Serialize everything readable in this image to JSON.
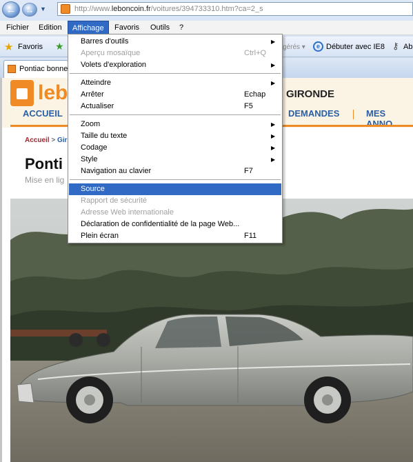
{
  "browser": {
    "url_prefix": "http://www.",
    "url_domain": "leboncoin.fr",
    "url_path": "/voitures/394733310.htm?ca=2_s",
    "menubar": [
      "Fichier",
      "Edition",
      "Affichage",
      "Favoris",
      "Outils",
      "?"
    ],
    "favorites_label": "Favoris",
    "favbar_partial": "gérés ▾",
    "ie8_label": "Débuter avec IE8",
    "ab_label": "Ab",
    "tab_title": "Pontiac bonneville"
  },
  "dropdown": {
    "items": [
      {
        "label": "Barres d'outils",
        "shortcut": "",
        "submenu": true,
        "disabled": false,
        "selected": false
      },
      {
        "label": "Aperçu mosaïque",
        "shortcut": "Ctrl+Q",
        "submenu": false,
        "disabled": true,
        "selected": false
      },
      {
        "label": "Volets d'exploration",
        "shortcut": "",
        "submenu": true,
        "disabled": false,
        "selected": false
      },
      {
        "label": "Atteindre",
        "shortcut": "",
        "submenu": true,
        "disabled": false,
        "selected": false
      },
      {
        "label": "Arrêter",
        "shortcut": "Echap",
        "submenu": false,
        "disabled": false,
        "selected": false
      },
      {
        "label": "Actualiser",
        "shortcut": "F5",
        "submenu": false,
        "disabled": false,
        "selected": false
      },
      {
        "label": "Zoom",
        "shortcut": "",
        "submenu": true,
        "disabled": false,
        "selected": false
      },
      {
        "label": "Taille du texte",
        "shortcut": "",
        "submenu": true,
        "disabled": false,
        "selected": false
      },
      {
        "label": "Codage",
        "shortcut": "",
        "submenu": true,
        "disabled": false,
        "selected": false
      },
      {
        "label": "Style",
        "shortcut": "",
        "submenu": true,
        "disabled": false,
        "selected": false
      },
      {
        "label": "Navigation au clavier",
        "shortcut": "F7",
        "submenu": false,
        "disabled": false,
        "selected": false
      },
      {
        "label": "Source",
        "shortcut": "",
        "submenu": false,
        "disabled": false,
        "selected": true
      },
      {
        "label": "Rapport de sécurité",
        "shortcut": "",
        "submenu": false,
        "disabled": true,
        "selected": false
      },
      {
        "label": "Adresse Web internationale",
        "shortcut": "",
        "submenu": false,
        "disabled": true,
        "selected": false
      },
      {
        "label": "Déclaration de confidentialité de la page Web...",
        "shortcut": "",
        "submenu": false,
        "disabled": false,
        "selected": false
      },
      {
        "label": "Plein écran",
        "shortcut": "F11",
        "submenu": false,
        "disabled": false,
        "selected": false
      }
    ]
  },
  "site": {
    "logo_text": "lebo",
    "region": "GIRONDE",
    "nav": [
      "ACCUEIL",
      "DEMANDES",
      "MES ANNO"
    ],
    "breadcrumb_home": "Accueil",
    "breadcrumb_sep": " > ",
    "breadcrumb_next": "Gir",
    "ad_title": "Ponti",
    "ad_date": "Mise en lig"
  },
  "colors": {
    "accent_orange": "#ef8a24",
    "menu_selection": "#316ac5",
    "site_blue": "#2a5ea5"
  }
}
